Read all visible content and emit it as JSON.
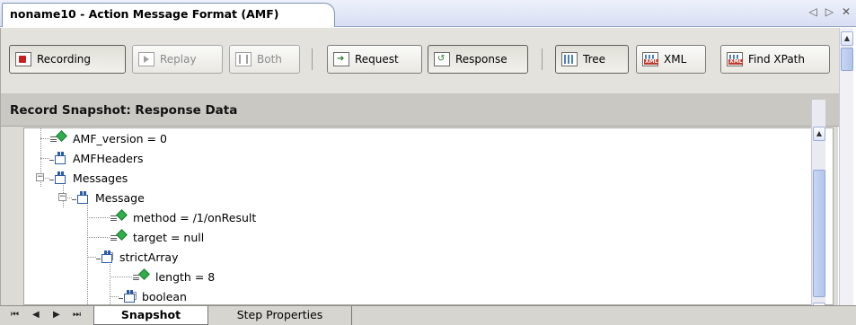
{
  "document_tab": {
    "title": "noname10 - Action Message Format (AMF)"
  },
  "tab_controls": {
    "prev": "◁",
    "next": "▷",
    "close": "✕"
  },
  "toolbar": {
    "recording": "Recording",
    "replay": "Replay",
    "both": "Both",
    "request": "Request",
    "response": "Response",
    "tree": "Tree",
    "xml": "XML",
    "find_xpath": "Find XPath"
  },
  "section": {
    "title": "Record Snapshot: Response Data"
  },
  "tree": {
    "nodes": [
      {
        "label": "AMF_version = 0",
        "kind": "leaf"
      },
      {
        "label": "AMFHeaders",
        "kind": "object"
      },
      {
        "label": "Messages",
        "kind": "object",
        "expander": "−"
      },
      {
        "label": "Message",
        "kind": "object",
        "expander": "−"
      },
      {
        "label": "method = /1/onResult",
        "kind": "leaf"
      },
      {
        "label": "target = null",
        "kind": "leaf"
      },
      {
        "label": "strictArray",
        "kind": "object",
        "expander": "−"
      },
      {
        "label": "length = 8",
        "kind": "leaf"
      },
      {
        "label": "boolean",
        "kind": "object",
        "expander": "+"
      }
    ]
  },
  "bottom_nav": {
    "first": "⏮",
    "prev": "◀",
    "next": "▶",
    "last": "⏭"
  },
  "bottom_tabs": {
    "snapshot": "Snapshot",
    "step_properties": "Step Properties"
  }
}
